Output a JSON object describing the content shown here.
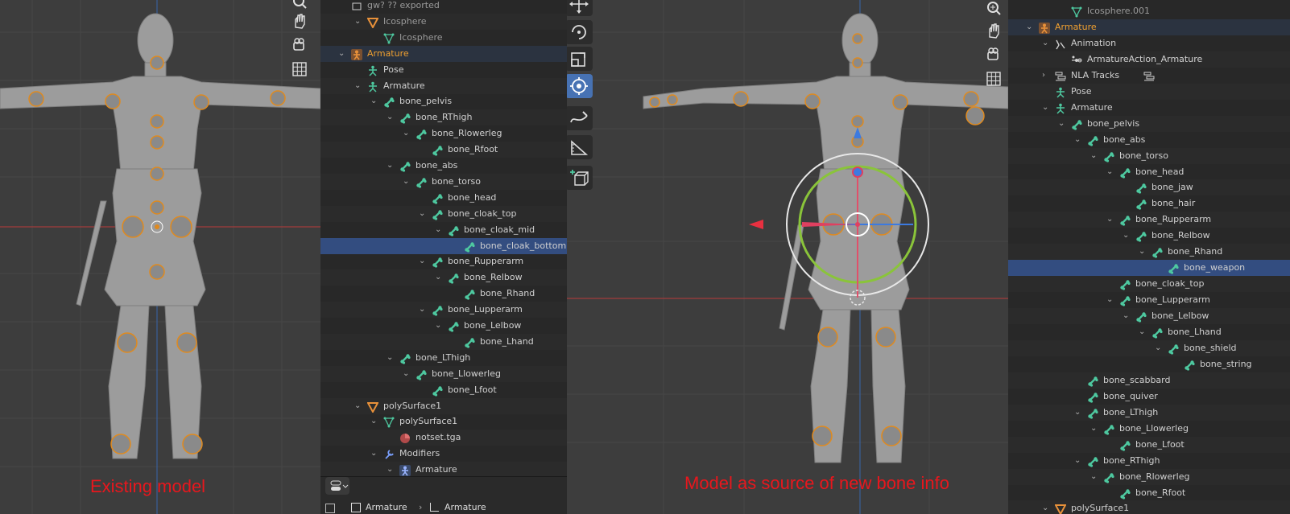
{
  "captions": {
    "left": "Existing model",
    "right": "Model as source of new bone info"
  },
  "colors": {
    "caption": "#e8171d",
    "armature_name": "#f0a030",
    "bone_icon": "#4ec9a0",
    "selection": "#334d80",
    "accent": "#4772b3"
  },
  "outliner_left": {
    "rows": [
      {
        "label": "gw? ?? exported",
        "icon": "collection-icon",
        "indent": 0
      },
      {
        "label": "Icosphere",
        "icon": "object-icon",
        "indent": 1
      },
      {
        "label": "Icosphere",
        "icon": "mesh-data-icon",
        "indent": 2
      },
      {
        "label": "Armature",
        "icon": "armature-object-icon",
        "indent": 0
      },
      {
        "label": "Pose",
        "icon": "pose-icon",
        "indent": 1
      },
      {
        "label": "Armature",
        "icon": "armature-data-icon",
        "indent": 1
      },
      {
        "label": "bone_pelvis",
        "icon": "bone-icon",
        "indent": 2
      },
      {
        "label": "bone_RThigh",
        "icon": "bone-icon",
        "indent": 3
      },
      {
        "label": "bone_Rlowerleg",
        "icon": "bone-icon",
        "indent": 4
      },
      {
        "label": "bone_Rfoot",
        "icon": "bone-icon",
        "indent": 5
      },
      {
        "label": "bone_abs",
        "icon": "bone-icon",
        "indent": 3
      },
      {
        "label": "bone_torso",
        "icon": "bone-icon",
        "indent": 4
      },
      {
        "label": "bone_head",
        "icon": "bone-icon",
        "indent": 5
      },
      {
        "label": "bone_cloak_top",
        "icon": "bone-icon",
        "indent": 5
      },
      {
        "label": "bone_cloak_mid",
        "icon": "bone-icon",
        "indent": 6
      },
      {
        "label": "bone_cloak_bottom",
        "icon": "bone-icon",
        "indent": 7
      },
      {
        "label": "bone_Rupperarm",
        "icon": "bone-icon",
        "indent": 5
      },
      {
        "label": "bone_Relbow",
        "icon": "bone-icon",
        "indent": 6
      },
      {
        "label": "bone_Rhand",
        "icon": "bone-icon",
        "indent": 7
      },
      {
        "label": "bone_Lupperarm",
        "icon": "bone-icon",
        "indent": 5
      },
      {
        "label": "bone_Lelbow",
        "icon": "bone-icon",
        "indent": 6
      },
      {
        "label": "bone_Lhand",
        "icon": "bone-icon",
        "indent": 7
      },
      {
        "label": "bone_LThigh",
        "icon": "bone-icon",
        "indent": 3
      },
      {
        "label": "bone_Llowerleg",
        "icon": "bone-icon",
        "indent": 4
      },
      {
        "label": "bone_Lfoot",
        "icon": "bone-icon",
        "indent": 5
      },
      {
        "label": "polySurface1",
        "icon": "object-icon",
        "indent": 1
      },
      {
        "label": "polySurface1",
        "icon": "mesh-data-icon",
        "indent": 2
      },
      {
        "label": "notset.tga",
        "icon": "material-icon",
        "indent": 3
      },
      {
        "label": "Modifiers",
        "icon": "wrench-icon",
        "indent": 2
      },
      {
        "label": "Armature",
        "icon": "armature-modifier-icon",
        "indent": 3
      }
    ],
    "breadcrumb": [
      "Armature",
      "Armature"
    ]
  },
  "outliner_right": {
    "rows": [
      {
        "label": "Icosphere.001",
        "icon": "mesh-data-icon",
        "indent": 2
      },
      {
        "label": "Armature",
        "icon": "armature-object-icon",
        "indent": 0
      },
      {
        "label": "Animation",
        "icon": "animation-icon",
        "indent": 1
      },
      {
        "label": "ArmatureAction_Armature",
        "icon": "action-icon",
        "indent": 2
      },
      {
        "label": "NLA Tracks",
        "icon": "nla-icon",
        "indent": 1
      },
      {
        "label": "Pose",
        "icon": "pose-icon",
        "indent": 1
      },
      {
        "label": "Armature",
        "icon": "armature-data-icon",
        "indent": 1
      },
      {
        "label": "bone_pelvis",
        "icon": "bone-icon",
        "indent": 2
      },
      {
        "label": "bone_abs",
        "icon": "bone-icon",
        "indent": 3
      },
      {
        "label": "bone_torso",
        "icon": "bone-icon",
        "indent": 4
      },
      {
        "label": "bone_head",
        "icon": "bone-icon",
        "indent": 5
      },
      {
        "label": "bone_jaw",
        "icon": "bone-icon",
        "indent": 6
      },
      {
        "label": "bone_hair",
        "icon": "bone-icon",
        "indent": 6
      },
      {
        "label": "bone_Rupperarm",
        "icon": "bone-icon",
        "indent": 5
      },
      {
        "label": "bone_Relbow",
        "icon": "bone-icon",
        "indent": 6
      },
      {
        "label": "bone_Rhand",
        "icon": "bone-icon",
        "indent": 7
      },
      {
        "label": "bone_weapon",
        "icon": "bone-icon",
        "indent": 8
      },
      {
        "label": "bone_cloak_top",
        "icon": "bone-icon",
        "indent": 5
      },
      {
        "label": "bone_Lupperarm",
        "icon": "bone-icon",
        "indent": 5
      },
      {
        "label": "bone_Lelbow",
        "icon": "bone-icon",
        "indent": 6
      },
      {
        "label": "bone_Lhand",
        "icon": "bone-icon",
        "indent": 7
      },
      {
        "label": "bone_shield",
        "icon": "bone-icon",
        "indent": 8
      },
      {
        "label": "bone_string",
        "icon": "bone-icon",
        "indent": 9
      },
      {
        "label": "bone_scabbard",
        "icon": "bone-icon",
        "indent": 3
      },
      {
        "label": "bone_quiver",
        "icon": "bone-icon",
        "indent": 3
      },
      {
        "label": "bone_LThigh",
        "icon": "bone-icon",
        "indent": 3
      },
      {
        "label": "bone_Llowerleg",
        "icon": "bone-icon",
        "indent": 4
      },
      {
        "label": "bone_Lfoot",
        "icon": "bone-icon",
        "indent": 5
      },
      {
        "label": "bone_RThigh",
        "icon": "bone-icon",
        "indent": 3
      },
      {
        "label": "bone_Rlowerleg",
        "icon": "bone-icon",
        "indent": 4
      },
      {
        "label": "bone_Rfoot",
        "icon": "bone-icon",
        "indent": 5
      },
      {
        "label": "polySurface1",
        "icon": "object-icon",
        "indent": 1
      }
    ]
  },
  "toolbar": {
    "tools": [
      "move-tool-icon",
      "rotate-tool-icon",
      "scale-tool-icon",
      "transform-tool-icon",
      "annotate-tool-icon",
      "measure-tool-icon",
      "add-cube-tool-icon"
    ],
    "active": "transform-tool-icon"
  },
  "nav_gizmo": [
    "zoom-icon",
    "hand-pan-icon",
    "camera-icon",
    "grid-view-icon"
  ]
}
